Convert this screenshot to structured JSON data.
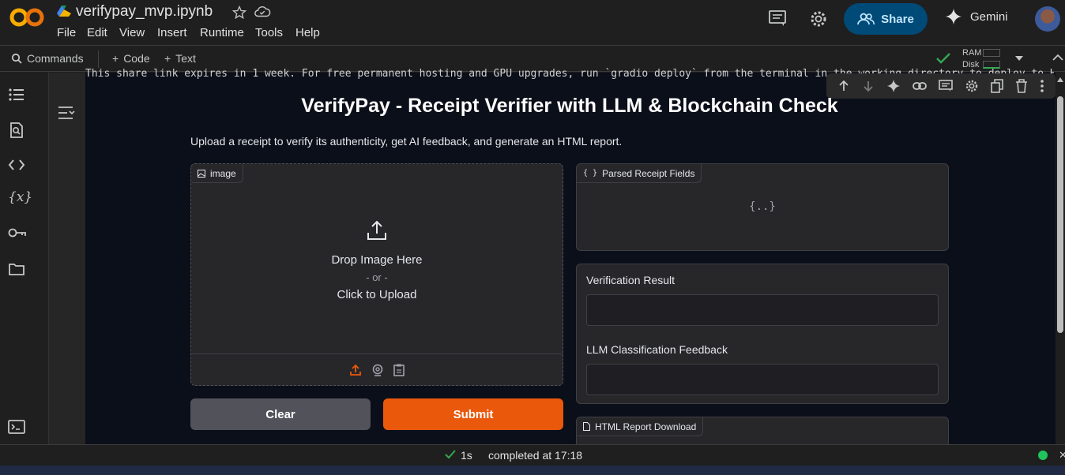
{
  "header": {
    "notebook_title": "verifypay_mvp.ipynb",
    "menu": [
      "File",
      "Edit",
      "View",
      "Insert",
      "Runtime",
      "Tools",
      "Help"
    ],
    "share_label": "Share",
    "gemini_label": "Gemini"
  },
  "toolbar": {
    "commands_label": "Commands",
    "code_label": "Code",
    "text_label": "Text",
    "ram_label": "RAM",
    "disk_label": "Disk"
  },
  "cell": {
    "share_message": "This share link expires in 1 week. For free permanent hosting and GPU upgrades, run `gradio deploy` from the terminal in the working directory to deploy to Hugging Face Spaces (https://huggingface.co/spaces)"
  },
  "app": {
    "title": "VerifyPay - Receipt Verifier with LLM & Blockchain Check",
    "description": "Upload a receipt to verify its authenticity, get AI feedback, and generate an HTML report.",
    "image_label": "image",
    "drop_text": "Drop Image Here",
    "or_text": "- or -",
    "click_text": "Click to Upload",
    "parsed_label": "Parsed Receipt Fields",
    "parsed_placeholder": "{..}",
    "verification_label": "Verification Result",
    "verification_value": "",
    "llm_label": "LLM Classification Feedback",
    "llm_value": "",
    "html_report_label": "HTML Report Download",
    "clear_label": "Clear",
    "submit_label": "Submit"
  },
  "status": {
    "duration": "1s",
    "completed_text": "completed at 17:18"
  },
  "colors": {
    "accent_orange": "#ea580c",
    "share_bg": "#004a77",
    "ok_green": "#34a853"
  }
}
